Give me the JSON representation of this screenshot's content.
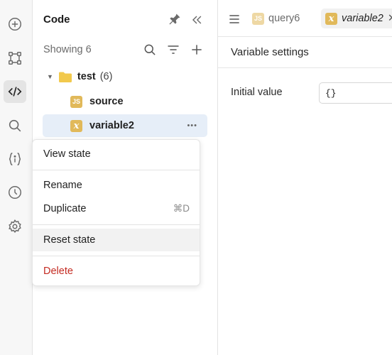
{
  "sidebar_rail": {
    "icons": [
      "plus-circle-icon",
      "workflow-icon",
      "code-icon",
      "search-icon",
      "state-icon",
      "history-icon",
      "settings-icon"
    ],
    "active": "code-icon"
  },
  "code_panel": {
    "title": "Code",
    "showing_label": "Showing 6",
    "folder": {
      "name": "test",
      "count": "(6)"
    },
    "items": [
      {
        "badge": "JS",
        "label": "source"
      },
      {
        "badge": "x",
        "label": "variable2"
      }
    ],
    "more_glyph": "•••"
  },
  "context_menu": {
    "view_state": "View state",
    "rename": "Rename",
    "duplicate": "Duplicate",
    "duplicate_shortcut": "⌘D",
    "reset_state": "Reset state",
    "delete": "Delete"
  },
  "tabs": [
    {
      "badge": "JS",
      "label": "query6",
      "active": false
    },
    {
      "badge": "x",
      "label": "variable2",
      "active": true
    }
  ],
  "settings": {
    "title": "Variable settings",
    "initial_value_label": "Initial value",
    "initial_value": "{}"
  },
  "colors": {
    "accent_selected": "#e6eef8",
    "badge": "#e1b95a",
    "danger": "#c42b22"
  }
}
